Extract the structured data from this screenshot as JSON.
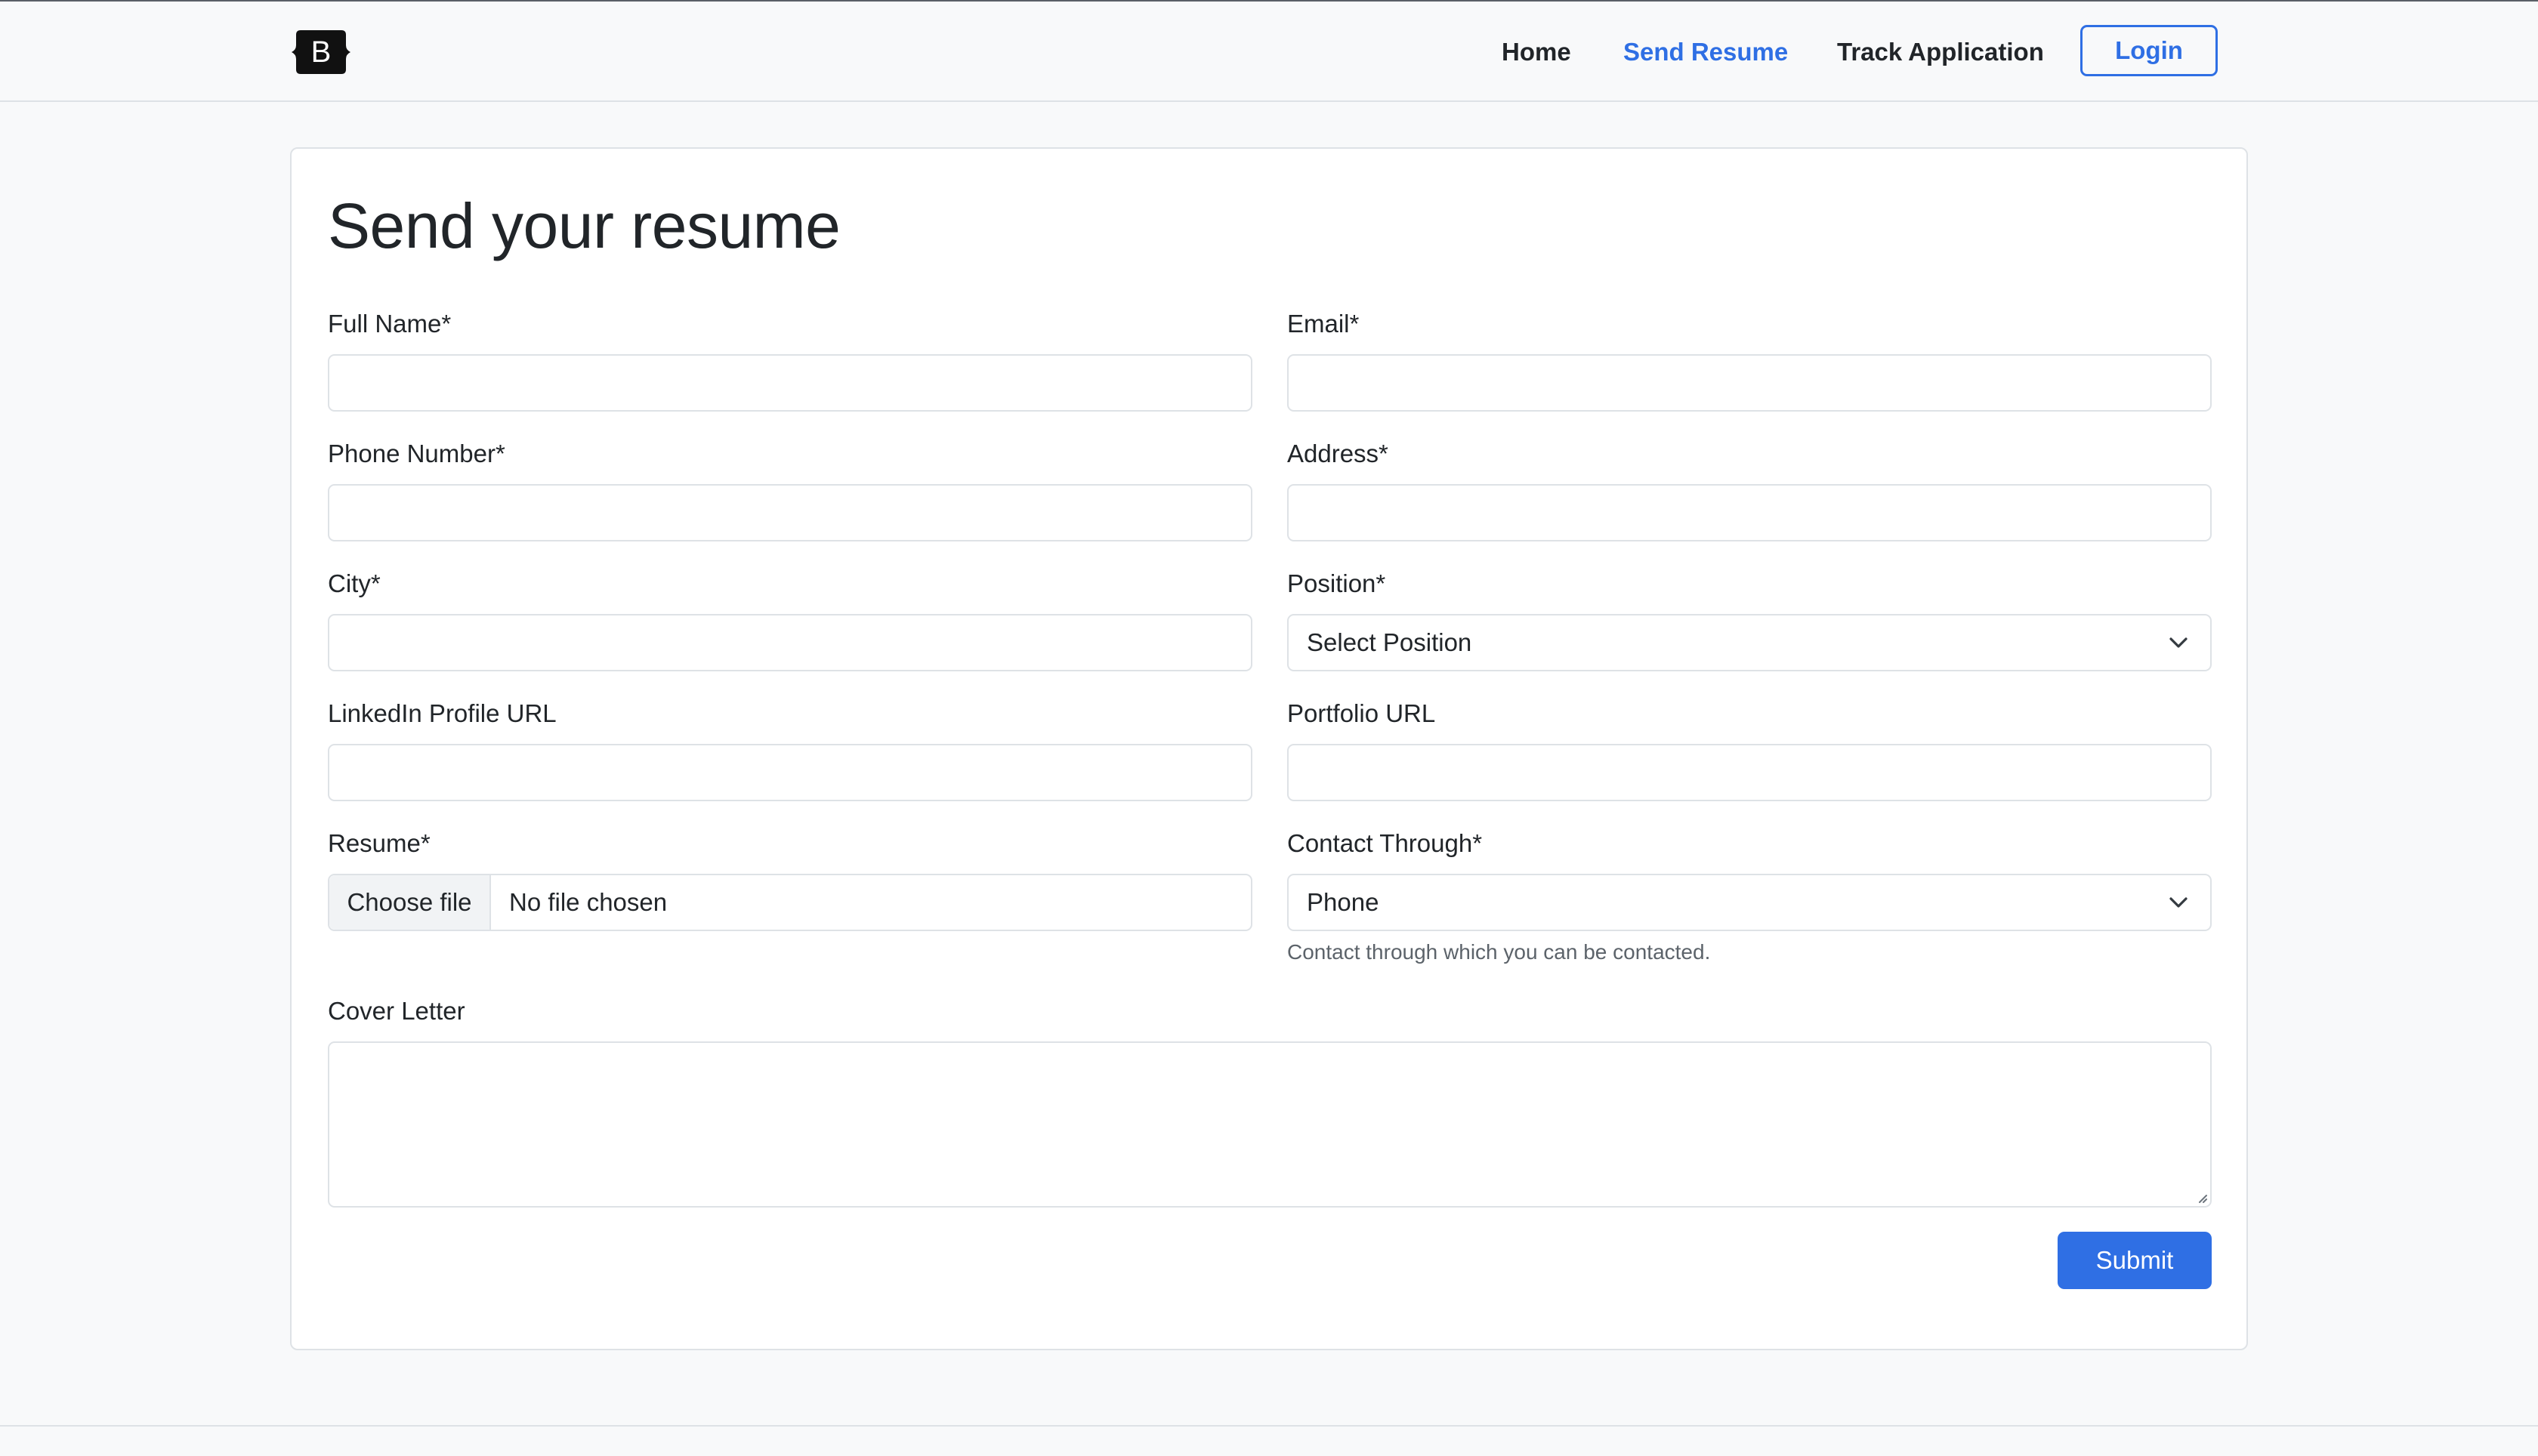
{
  "navbar": {
    "brand_letter": "B",
    "links": [
      {
        "label": "Home",
        "active": false
      },
      {
        "label": "Send Resume",
        "active": true
      },
      {
        "label": "Track Application",
        "active": false
      }
    ],
    "login_label": "Login"
  },
  "form": {
    "title": "Send your resume",
    "full_name": {
      "label": "Full Name*",
      "value": ""
    },
    "email": {
      "label": "Email*",
      "value": ""
    },
    "phone": {
      "label": "Phone Number*",
      "value": ""
    },
    "address": {
      "label": "Address*",
      "value": ""
    },
    "city": {
      "label": "City*",
      "value": ""
    },
    "position": {
      "label": "Position*",
      "selected": "Select Position"
    },
    "linkedin": {
      "label": "LinkedIn Profile URL",
      "value": ""
    },
    "portfolio": {
      "label": "Portfolio URL",
      "value": ""
    },
    "resume": {
      "label": "Resume*",
      "button_label": "Choose file",
      "status": "No file chosen"
    },
    "contact_through": {
      "label": "Contact Through*",
      "selected": "Phone",
      "help": "Contact through which you can be contacted."
    },
    "cover_letter": {
      "label": "Cover Letter",
      "value": ""
    },
    "submit_label": "Submit"
  },
  "colors": {
    "primary": "#2f6fe4",
    "page_background": "#f8f9fa",
    "border": "#dee2e6"
  },
  "icons": [
    "bootstrap-logo-icon",
    "chevron-down-icon",
    "resize-grip-icon"
  ]
}
